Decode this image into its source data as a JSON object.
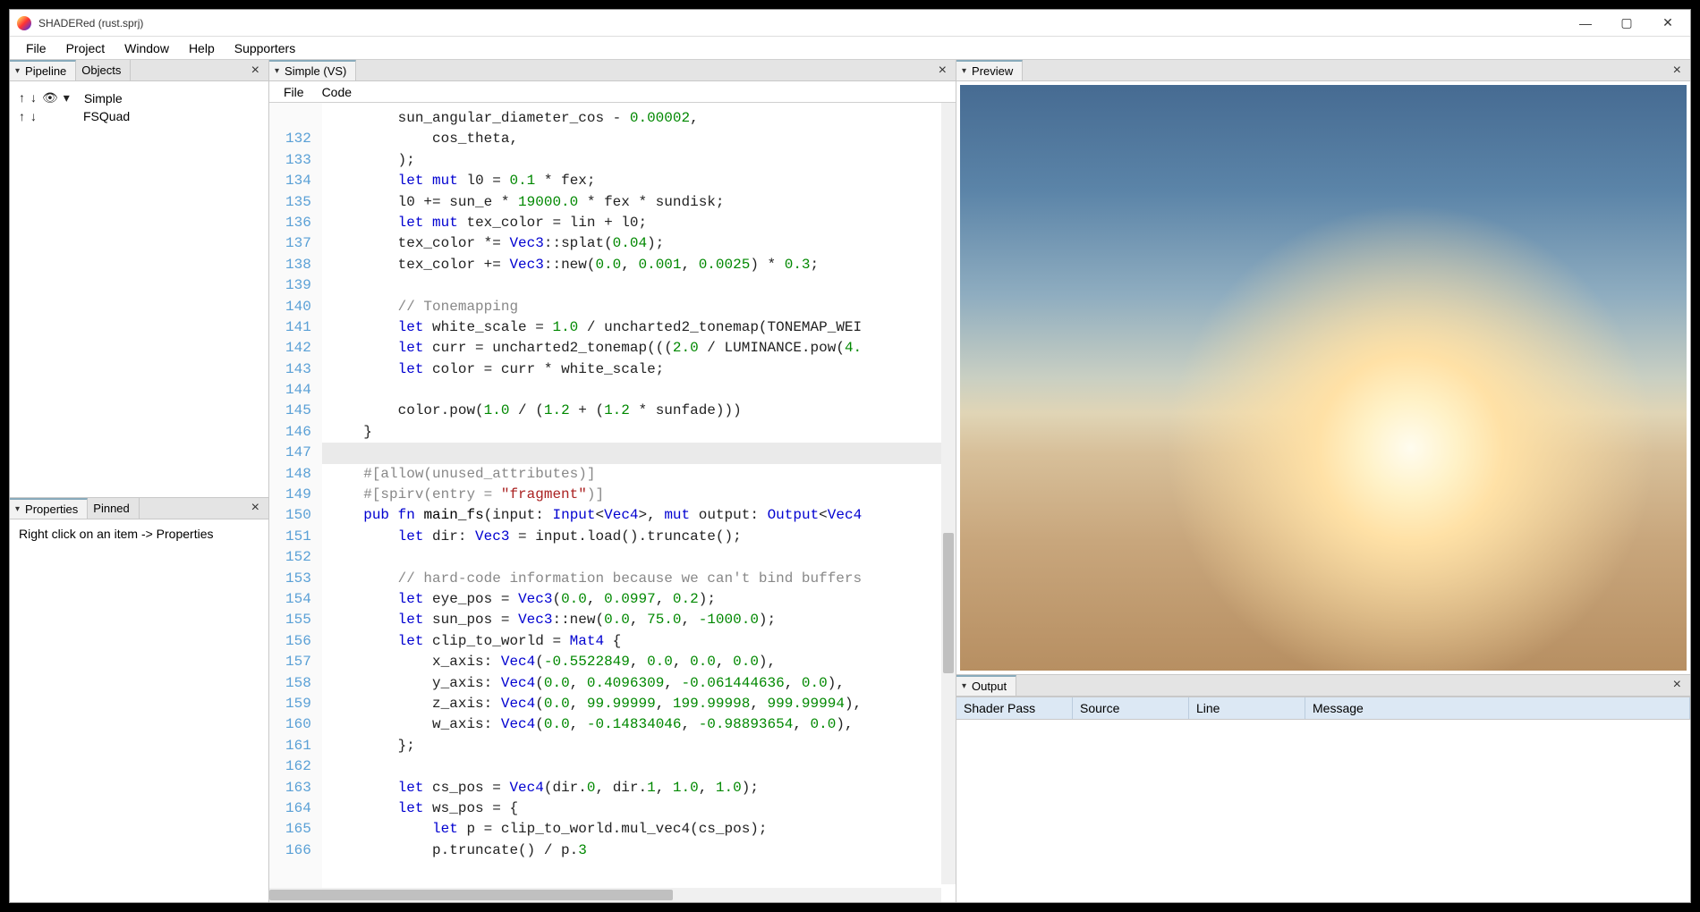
{
  "window": {
    "title": "SHADERed (rust.sprj)"
  },
  "menubar": [
    "File",
    "Project",
    "Window",
    "Help",
    "Supporters"
  ],
  "sidebar": {
    "tabs": {
      "pipeline": "Pipeline",
      "objects": "Objects"
    },
    "items": [
      {
        "icons": [
          "↑",
          "↓",
          "👁",
          "▾"
        ],
        "label": "Simple"
      },
      {
        "icons": [
          "↑",
          "↓"
        ],
        "label": "FSQuad"
      }
    ]
  },
  "properties": {
    "tabs": {
      "properties": "Properties",
      "pinned": "Pinned"
    },
    "hint": "Right click on an item -> Properties"
  },
  "editor": {
    "tab": "Simple (VS)",
    "submenu": [
      "File",
      "Code"
    ],
    "first_line": 132,
    "lines": [
      {
        "n": "",
        "html": "        sun_angular_diameter_cos - <span class='num'>0.00002</span>,"
      },
      {
        "n": 132,
        "html": "            cos_theta,"
      },
      {
        "n": 133,
        "html": "        );"
      },
      {
        "n": 134,
        "html": "        <span class='kw'>let</span> <span class='kw'>mut</span> l0 = <span class='num'>0.1</span> * fex;"
      },
      {
        "n": 135,
        "html": "        l0 += sun_e * <span class='num'>19000.0</span> * fex * sundisk;"
      },
      {
        "n": 136,
        "html": "        <span class='kw'>let</span> <span class='kw'>mut</span> tex_color = lin + l0;"
      },
      {
        "n": 137,
        "html": "        tex_color *= <span class='type'>Vec3</span>::splat(<span class='num'>0.04</span>);"
      },
      {
        "n": 138,
        "html": "        tex_color += <span class='type'>Vec3</span>::new(<span class='num'>0.0</span>, <span class='num'>0.001</span>, <span class='num'>0.0025</span>) * <span class='num'>0.3</span>;"
      },
      {
        "n": 139,
        "html": ""
      },
      {
        "n": 140,
        "html": "        <span class='cm'>// Tonemapping</span>"
      },
      {
        "n": 141,
        "html": "        <span class='kw'>let</span> white_scale = <span class='num'>1.0</span> / uncharted2_tonemap(TONEMAP_WEI"
      },
      {
        "n": 142,
        "html": "        <span class='kw'>let</span> curr = uncharted2_tonemap(((<span class='num'>2.0</span> / LUMINANCE.pow(<span class='num'>4.</span>"
      },
      {
        "n": 143,
        "html": "        <span class='kw'>let</span> color = curr * white_scale;"
      },
      {
        "n": 144,
        "html": ""
      },
      {
        "n": 145,
        "html": "        color.pow(<span class='num'>1.0</span> / (<span class='num'>1.2</span> + (<span class='num'>1.2</span> * sunfade)))"
      },
      {
        "n": 146,
        "html": "    }"
      },
      {
        "n": 147,
        "html": "",
        "hl": true
      },
      {
        "n": 148,
        "html": "    <span class='attr'>#[allow(unused_attributes)]</span>"
      },
      {
        "n": 149,
        "html": "    <span class='attr'>#[spirv(entry = <span class='str'>\"fragment\"</span>)]</span>"
      },
      {
        "n": 150,
        "html": "    <span class='kw'>pub</span> <span class='kw'>fn</span> <span class='fnname'>main_fs</span>(input: <span class='type'>Input</span>&lt;<span class='type'>Vec4</span>&gt;, <span class='kw'>mut</span> output: <span class='type'>Output</span>&lt;<span class='type'>Vec4</span>"
      },
      {
        "n": 151,
        "html": "        <span class='kw'>let</span> dir: <span class='type'>Vec3</span> = input.load().truncate();"
      },
      {
        "n": 152,
        "html": ""
      },
      {
        "n": 153,
        "html": "        <span class='cm'>// hard-code information because we can't bind buffers</span>"
      },
      {
        "n": 154,
        "html": "        <span class='kw'>let</span> eye_pos = <span class='type'>Vec3</span>(<span class='num'>0.0</span>, <span class='num'>0.0997</span>, <span class='num'>0.2</span>);"
      },
      {
        "n": 155,
        "html": "        <span class='kw'>let</span> sun_pos = <span class='type'>Vec3</span>::new(<span class='num'>0.0</span>, <span class='num'>75.0</span>, <span class='num'>-1000.0</span>);"
      },
      {
        "n": 156,
        "html": "        <span class='kw'>let</span> clip_to_world = <span class='type'>Mat4</span> {"
      },
      {
        "n": 157,
        "html": "            x_axis: <span class='type'>Vec4</span>(<span class='num'>-0.5522849</span>, <span class='num'>0.0</span>, <span class='num'>0.0</span>, <span class='num'>0.0</span>),"
      },
      {
        "n": 158,
        "html": "            y_axis: <span class='type'>Vec4</span>(<span class='num'>0.0</span>, <span class='num'>0.4096309</span>, <span class='num'>-0.061444636</span>, <span class='num'>0.0</span>),"
      },
      {
        "n": 159,
        "html": "            z_axis: <span class='type'>Vec4</span>(<span class='num'>0.0</span>, <span class='num'>99.99999</span>, <span class='num'>199.99998</span>, <span class='num'>999.99994</span>),"
      },
      {
        "n": 160,
        "html": "            w_axis: <span class='type'>Vec4</span>(<span class='num'>0.0</span>, <span class='num'>-0.14834046</span>, <span class='num'>-0.98893654</span>, <span class='num'>0.0</span>),"
      },
      {
        "n": 161,
        "html": "        };"
      },
      {
        "n": 162,
        "html": ""
      },
      {
        "n": 163,
        "html": "        <span class='kw'>let</span> cs_pos = <span class='type'>Vec4</span>(dir.<span class='num'>0</span>, dir.<span class='num'>1</span>, <span class='num'>1.0</span>, <span class='num'>1.0</span>);"
      },
      {
        "n": 164,
        "html": "        <span class='kw'>let</span> ws_pos = {"
      },
      {
        "n": 165,
        "html": "            <span class='kw'>let</span> p = clip_to_world.mul_vec4(cs_pos);"
      },
      {
        "n": 166,
        "html": "            p.truncate() / p.<span class='num'>3</span>"
      }
    ]
  },
  "preview": {
    "title": "Preview"
  },
  "output": {
    "title": "Output",
    "columns": [
      "Shader Pass",
      "Source",
      "Line",
      "Message"
    ]
  }
}
